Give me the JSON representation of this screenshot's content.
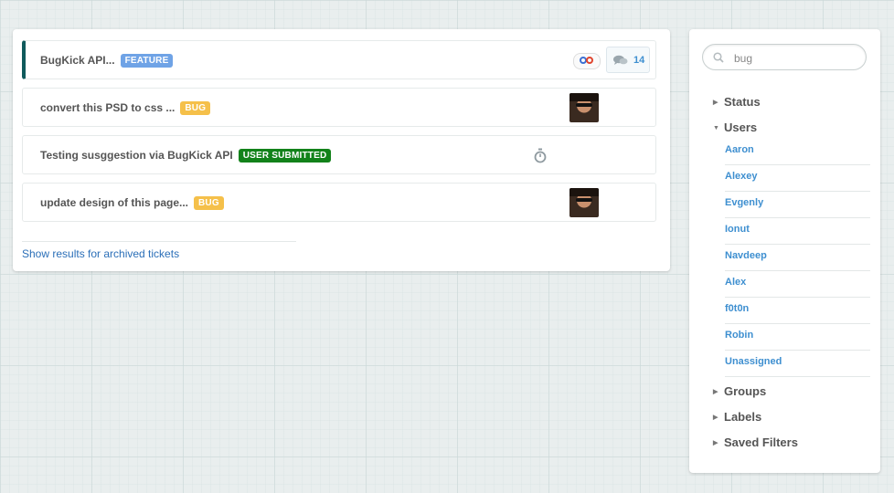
{
  "tickets": [
    {
      "title": "BugKick API...",
      "badge": "FEATURE",
      "badge_color": "#6fa3e6",
      "comment_count": "14"
    },
    {
      "title": "convert this PSD to css ...",
      "badge": "BUG",
      "badge_color": "#f5c04a"
    },
    {
      "title": "Testing susggestion via BugKick API",
      "badge": "USER SUBMITTED",
      "badge_color": "#12821a"
    },
    {
      "title": "update design of this page...",
      "badge": "BUG",
      "badge_color": "#f5c04a"
    }
  ],
  "archived_link": "Show results for archived tickets",
  "sidebar": {
    "search_value": "bug",
    "sections": {
      "status": "Status",
      "users": "Users",
      "groups": "Groups",
      "labels": "Labels",
      "saved_filters": "Saved Filters"
    },
    "users": [
      "Aaron",
      "Alexey",
      "Evgenly",
      "Ionut",
      "Navdeep",
      "Alex",
      "f0t0n",
      "Robin",
      "Unassigned"
    ]
  },
  "colors": {
    "active_marker": "#0f5a5c",
    "link": "#2b6fb8",
    "user_link": "#3e8fd0"
  }
}
